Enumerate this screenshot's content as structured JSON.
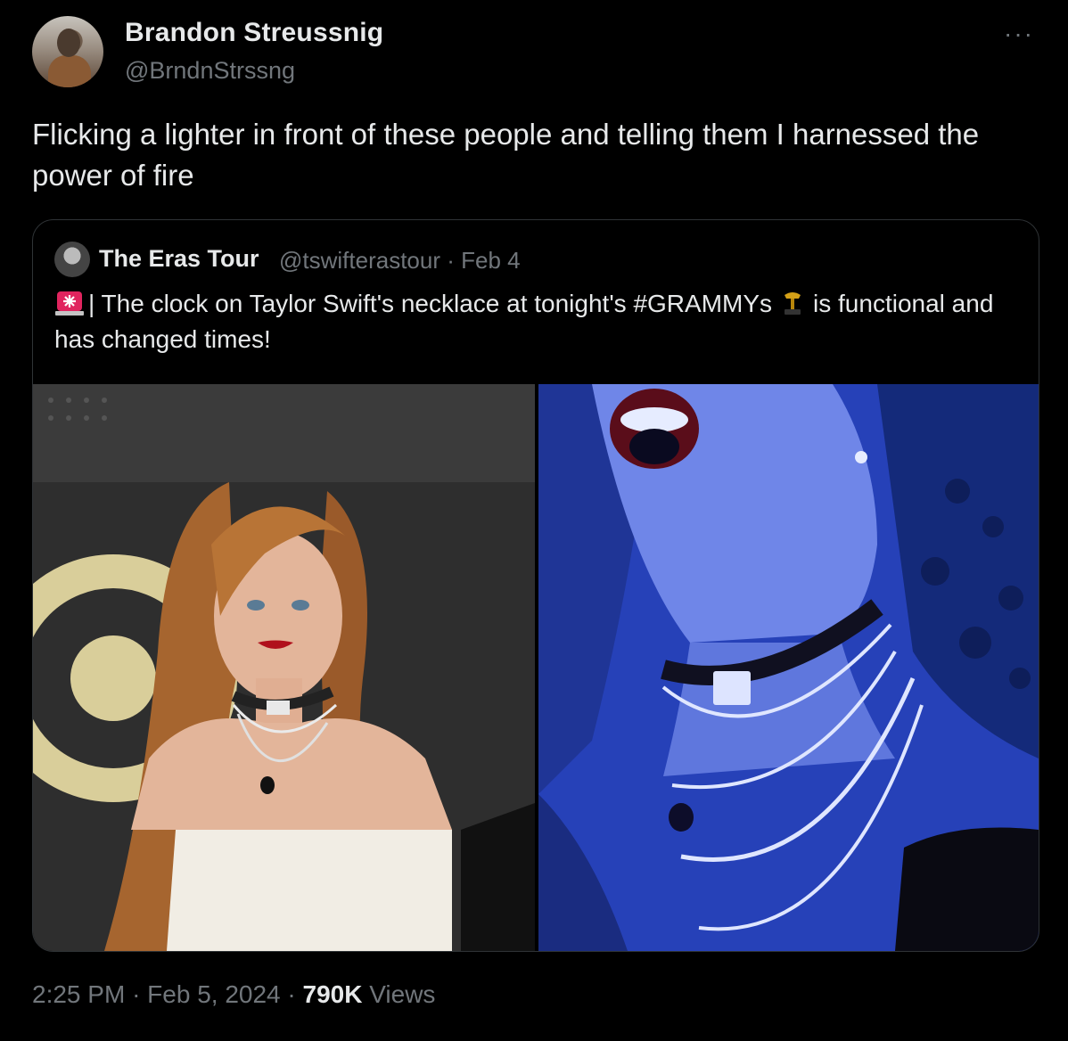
{
  "author": {
    "name": "Brandon Streussnig",
    "handle": "@BrndnStrssng"
  },
  "more_icon": "···",
  "tweet": {
    "text": "Flicking a lighter in front of these people and telling them I harnessed the power of fire"
  },
  "quoted_tweet": {
    "author_name": "The Eras Tour",
    "author_handle": "@tswifterastour",
    "separator": "·",
    "date": "Feb 4",
    "text_part1": "| The clock on Taylor Swift's necklace at tonight's #GRAMMYs",
    "text_part2": "is functional and has changed times!",
    "icons": [
      "siren-emoji",
      "trophy-emoji"
    ]
  },
  "footer": {
    "time": "2:25 PM",
    "sep1": "·",
    "date": "Feb 5, 2024",
    "sep2": "·",
    "views_count": "790K",
    "views_label": "Views"
  },
  "colors": {
    "background": "#000000",
    "text_primary": "#e7e9ea",
    "text_secondary": "#71767b",
    "border": "#2f3336"
  }
}
